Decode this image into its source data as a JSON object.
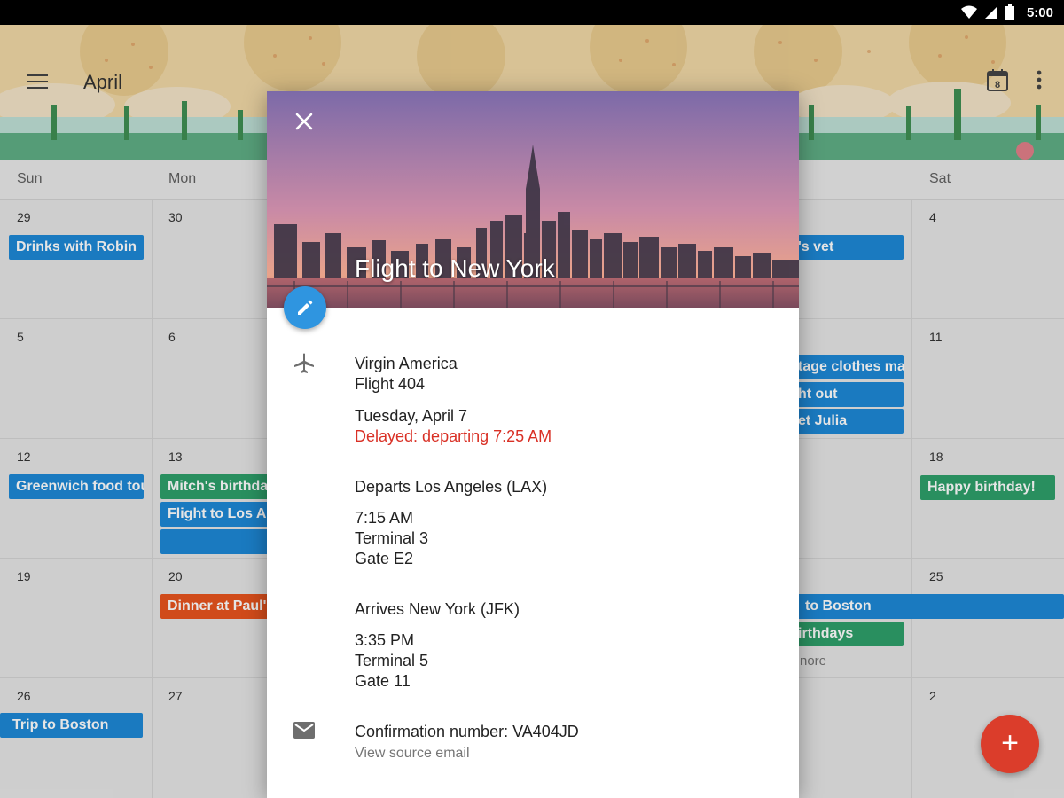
{
  "status_bar": {
    "time": "5:00"
  },
  "app_bar": {
    "title": "April"
  },
  "weekdays": [
    "Sun",
    "Mon",
    "Sat"
  ],
  "day_numbers": [
    "29",
    "30",
    "4",
    "5",
    "6",
    "11",
    "12",
    "13",
    "18",
    "19",
    "20",
    "25",
    "26",
    "27",
    "2"
  ],
  "events": [
    "Drinks with Robin",
    "Greenwich food tou",
    "Mitch's birthday",
    "Flight to Los An",
    "Happy birthday!",
    "Dinner at Paul's",
    "Trip to Boston",
    "'s vet",
    "tage clothes ma",
    "ht out",
    "et Julia",
    "to Boston",
    "irthdays"
  ],
  "more_link": "nore",
  "event_card": {
    "title": "Flight to New York",
    "airline": "Virgin America",
    "flight": "Flight 404",
    "date": "Tuesday, April 7",
    "delay": "Delayed: departing 7:25 AM",
    "departs_heading": "Departs Los Angeles (LAX)",
    "departs_time": "7:15 AM",
    "departs_terminal": "Terminal 3",
    "departs_gate": "Gate E2",
    "arrives_heading": "Arrives New York (JFK)",
    "arrives_time": "3:35 PM",
    "arrives_terminal": "Terminal 5",
    "arrives_gate": "Gate 11",
    "confirmation": "Confirmation number: VA404JD",
    "source_link": "View source email"
  },
  "calendar_icon_day": "8",
  "fab_symbol": "+",
  "colors": {
    "event_blue": "#1e88d6",
    "event_green": "#2ea06a",
    "event_orange": "#e8541d",
    "fab_red": "#db3d2b",
    "edit_blue": "#2f95e0",
    "delay_red": "#d93025"
  }
}
